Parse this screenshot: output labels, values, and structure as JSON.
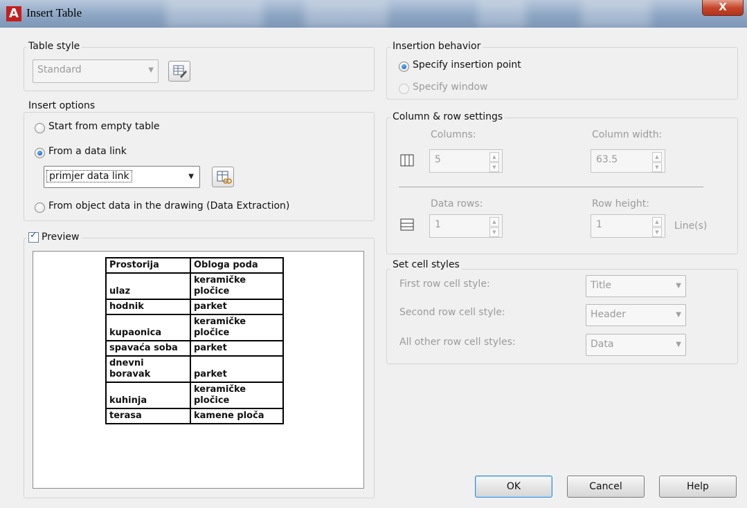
{
  "window": {
    "title": "Insert Table",
    "app_icon_letter": "A",
    "close_glyph": "X"
  },
  "table_style": {
    "legend": "Table style",
    "value": "Standard"
  },
  "insert_options": {
    "legend": "Insert options",
    "start_empty": "Start from empty table",
    "from_data_link": "From a data link",
    "data_link_value": "primjer data link",
    "from_object_data": "From object data in the drawing (Data Extraction)",
    "selected": "from_data_link"
  },
  "preview": {
    "label": "Preview",
    "checked": true,
    "rows": [
      [
        "Prostorija",
        "Obloga poda"
      ],
      [
        "ulaz",
        "keramičke pločice"
      ],
      [
        "hodnik",
        "parket"
      ],
      [
        "kupaonica",
        "keramičke pločice"
      ],
      [
        "spavaća soba",
        "parket"
      ],
      [
        "dnevni boravak",
        "parket"
      ],
      [
        "kuhinja",
        "keramičke pločice"
      ],
      [
        "terasa",
        "kamene ploča"
      ]
    ]
  },
  "insertion_behavior": {
    "legend": "Insertion behavior",
    "specify_point": "Specify insertion point",
    "specify_window": "Specify window",
    "selected": "specify_point"
  },
  "column_row": {
    "legend": "Column & row settings",
    "columns_label": "Columns:",
    "columns_value": "5",
    "column_width_label": "Column width:",
    "column_width_value": "63.5",
    "data_rows_label": "Data rows:",
    "data_rows_value": "1",
    "row_height_label": "Row height:",
    "row_height_value": "1",
    "row_height_unit": "Line(s)"
  },
  "cell_styles": {
    "legend": "Set cell styles",
    "first_label": "First row cell style:",
    "first_value": "Title",
    "second_label": "Second row cell style:",
    "second_value": "Header",
    "other_label": "All other row cell styles:",
    "other_value": "Data"
  },
  "buttons": {
    "ok": "OK",
    "cancel": "Cancel",
    "help": "Help"
  }
}
